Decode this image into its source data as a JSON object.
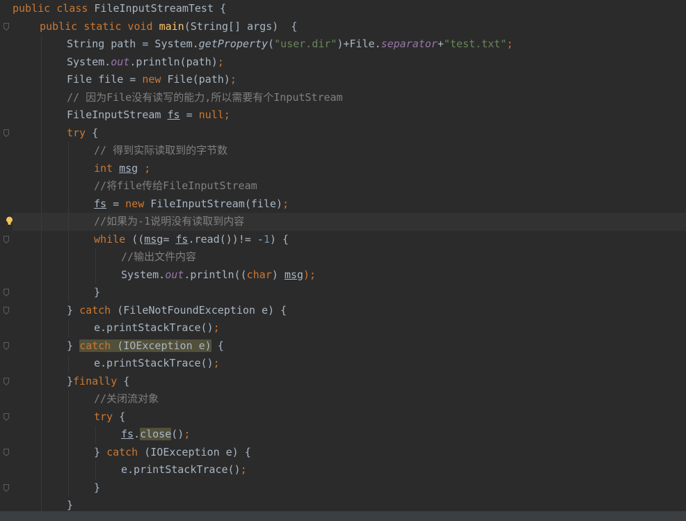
{
  "editor": {
    "lines": [
      {
        "indent": 0,
        "current": false,
        "bulb": false,
        "fold": false,
        "tokens": [
          {
            "t": "public class ",
            "c": "kw"
          },
          {
            "t": "FileInputStreamTest {"
          }
        ]
      },
      {
        "indent": 1,
        "current": false,
        "bulb": false,
        "fold": true,
        "tokens": [
          {
            "t": "public static void ",
            "c": "kw"
          },
          {
            "t": "main",
            "c": "fn"
          },
          {
            "t": "(String[] args)  {"
          }
        ]
      },
      {
        "indent": 2,
        "current": false,
        "bulb": false,
        "fold": false,
        "tokens": [
          {
            "t": "String path = System."
          },
          {
            "t": "getProperty",
            "c": "it"
          },
          {
            "t": "("
          },
          {
            "t": "\"user.dir\"",
            "c": "str"
          },
          {
            "t": ")+File."
          },
          {
            "t": "separator",
            "c": "st"
          },
          {
            "t": "+"
          },
          {
            "t": "\"test.txt\"",
            "c": "str"
          },
          {
            "t": ";",
            "c": "kw"
          }
        ]
      },
      {
        "indent": 2,
        "current": false,
        "bulb": false,
        "fold": false,
        "tokens": [
          {
            "t": "System."
          },
          {
            "t": "out",
            "c": "st"
          },
          {
            "t": ".println(path)"
          },
          {
            "t": ";",
            "c": "kw"
          }
        ]
      },
      {
        "indent": 2,
        "current": false,
        "bulb": false,
        "fold": false,
        "tokens": [
          {
            "t": "File file = "
          },
          {
            "t": "new ",
            "c": "kw"
          },
          {
            "t": "File(path)"
          },
          {
            "t": ";",
            "c": "kw"
          }
        ]
      },
      {
        "indent": 2,
        "current": false,
        "bulb": false,
        "fold": false,
        "tokens": [
          {
            "t": "// 因为File没有读写的能力,所以需要有个InputStream",
            "c": "cm"
          }
        ]
      },
      {
        "indent": 2,
        "current": false,
        "bulb": false,
        "fold": false,
        "tokens": [
          {
            "t": "FileInputStream "
          },
          {
            "t": "fs",
            "c": "ul"
          },
          {
            "t": " = "
          },
          {
            "t": "null;",
            "c": "kw"
          }
        ]
      },
      {
        "indent": 2,
        "current": false,
        "bulb": false,
        "fold": true,
        "tokens": [
          {
            "t": "try ",
            "c": "kw"
          },
          {
            "t": "{"
          }
        ]
      },
      {
        "indent": 3,
        "current": false,
        "bulb": false,
        "fold": false,
        "tokens": [
          {
            "t": "// 得到实际读取到的字节数",
            "c": "cm"
          }
        ]
      },
      {
        "indent": 3,
        "current": false,
        "bulb": false,
        "fold": false,
        "tokens": [
          {
            "t": "int ",
            "c": "kw"
          },
          {
            "t": "msg",
            "c": "ul"
          },
          {
            "t": " ;",
            "c": "kw"
          }
        ]
      },
      {
        "indent": 3,
        "current": false,
        "bulb": false,
        "fold": false,
        "tokens": [
          {
            "t": "//将file传给FileInputStream",
            "c": "cm"
          }
        ]
      },
      {
        "indent": 3,
        "current": false,
        "bulb": false,
        "fold": false,
        "tokens": [
          {
            "t": "fs",
            "c": "ul"
          },
          {
            "t": " = "
          },
          {
            "t": "new ",
            "c": "kw"
          },
          {
            "t": "FileInputStream(file)"
          },
          {
            "t": ";",
            "c": "kw"
          }
        ]
      },
      {
        "indent": 3,
        "current": true,
        "bulb": true,
        "fold": false,
        "tokens": [
          {
            "t": "//如果为-1说明没有读取到内容",
            "c": "cm"
          }
        ]
      },
      {
        "indent": 3,
        "current": false,
        "bulb": false,
        "fold": true,
        "tokens": [
          {
            "t": "while ",
            "c": "kw"
          },
          {
            "t": "(("
          },
          {
            "t": "msg",
            "c": "ul"
          },
          {
            "t": "= "
          },
          {
            "t": "fs",
            "c": "ul"
          },
          {
            "t": ".read())!= -"
          },
          {
            "t": "1",
            "c": "num"
          },
          {
            "t": ") {"
          }
        ]
      },
      {
        "indent": 4,
        "current": false,
        "bulb": false,
        "fold": false,
        "tokens": [
          {
            "t": "//输出文件内容",
            "c": "cm"
          }
        ]
      },
      {
        "indent": 4,
        "current": false,
        "bulb": false,
        "fold": false,
        "tokens": [
          {
            "t": "System."
          },
          {
            "t": "out",
            "c": "st"
          },
          {
            "t": ".println(("
          },
          {
            "t": "char",
            "c": "kw"
          },
          {
            "t": ") "
          },
          {
            "t": "msg",
            "c": "ul"
          },
          {
            "t": ");",
            "c": "kw"
          }
        ]
      },
      {
        "indent": 3,
        "current": false,
        "bulb": false,
        "fold": true,
        "tokens": [
          {
            "t": "}"
          }
        ]
      },
      {
        "indent": 2,
        "current": false,
        "bulb": false,
        "fold": true,
        "tokens": [
          {
            "t": "} "
          },
          {
            "t": "catch ",
            "c": "kw"
          },
          {
            "t": "(FileNotFoundException e) {"
          }
        ]
      },
      {
        "indent": 3,
        "current": false,
        "bulb": false,
        "fold": false,
        "tokens": [
          {
            "t": "e.printStackTrace()"
          },
          {
            "t": ";",
            "c": "kw"
          }
        ]
      },
      {
        "indent": 2,
        "current": false,
        "bulb": false,
        "fold": true,
        "tokens": [
          {
            "t": "} "
          },
          {
            "t": "catch",
            "c": "kw hl"
          },
          {
            "t": " (IOException e)",
            "c": "hl"
          },
          {
            "t": " {"
          }
        ]
      },
      {
        "indent": 3,
        "current": false,
        "bulb": false,
        "fold": false,
        "tokens": [
          {
            "t": "e.printStackTrace()"
          },
          {
            "t": ";",
            "c": "kw"
          }
        ]
      },
      {
        "indent": 2,
        "current": false,
        "bulb": false,
        "fold": true,
        "tokens": [
          {
            "t": "}"
          },
          {
            "t": "finally ",
            "c": "kw"
          },
          {
            "t": "{"
          }
        ]
      },
      {
        "indent": 3,
        "current": false,
        "bulb": false,
        "fold": false,
        "tokens": [
          {
            "t": "//关闭流对象",
            "c": "cm"
          }
        ]
      },
      {
        "indent": 3,
        "current": false,
        "bulb": false,
        "fold": true,
        "tokens": [
          {
            "t": "try ",
            "c": "kw"
          },
          {
            "t": "{"
          }
        ]
      },
      {
        "indent": 4,
        "current": false,
        "bulb": false,
        "fold": false,
        "tokens": [
          {
            "t": "fs",
            "c": "ul"
          },
          {
            "t": "."
          },
          {
            "t": "close",
            "c": "hl"
          },
          {
            "t": "()"
          },
          {
            "t": ";",
            "c": "kw"
          }
        ]
      },
      {
        "indent": 3,
        "current": false,
        "bulb": false,
        "fold": true,
        "tokens": [
          {
            "t": "} "
          },
          {
            "t": "catch ",
            "c": "kw"
          },
          {
            "t": "(IOException e) {"
          }
        ]
      },
      {
        "indent": 4,
        "current": false,
        "bulb": false,
        "fold": false,
        "tokens": [
          {
            "t": "e.printStackTrace()"
          },
          {
            "t": ";",
            "c": "kw"
          }
        ]
      },
      {
        "indent": 3,
        "current": false,
        "bulb": false,
        "fold": true,
        "tokens": [
          {
            "t": "}"
          }
        ]
      },
      {
        "indent": 2,
        "current": false,
        "bulb": false,
        "fold": false,
        "tokens": [
          {
            "t": "}"
          }
        ]
      }
    ]
  }
}
